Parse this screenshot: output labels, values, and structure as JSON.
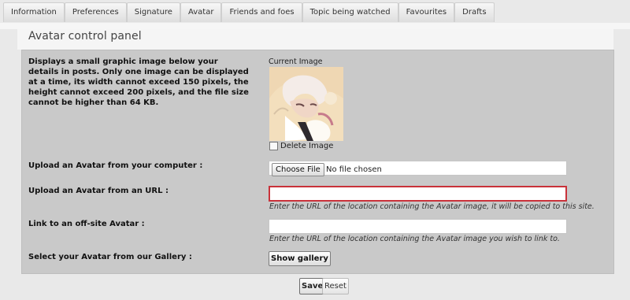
{
  "tabs": [
    {
      "label": "Information"
    },
    {
      "label": "Preferences"
    },
    {
      "label": "Signature"
    },
    {
      "label": "Avatar"
    },
    {
      "label": "Friends and foes"
    },
    {
      "label": "Topic being watched"
    },
    {
      "label": "Favourites"
    },
    {
      "label": "Drafts"
    }
  ],
  "panel": {
    "title": "Avatar control panel",
    "description": "Displays a small graphic image below your details in posts. Only one image can be displayed at a time, its width cannot exceed 150 pixels, the height cannot exceed 200 pixels, and the file size cannot be higher than 64 KB.",
    "current_image_label": "Current Image",
    "delete_image_label": "Delete Image",
    "delete_image_checked": false
  },
  "upload_computer": {
    "label": "Upload an Avatar from your computer :",
    "button_label": "Choose File",
    "status_text": "No file chosen"
  },
  "upload_url": {
    "label": "Upload an Avatar from an URL :",
    "value": "",
    "hint": "Enter the URL of the location containing the Avatar image, it will be copied to this site."
  },
  "link_offsite": {
    "label": "Link to an off-site Avatar :",
    "value": "",
    "hint": "Enter the URL of the location containing the Avatar image you wish to link to."
  },
  "gallery": {
    "label": "Select your Avatar from our Gallery :",
    "button_label": "Show gallery"
  },
  "actions": {
    "save_label": "Save",
    "reset_label": "Reset"
  },
  "colors": {
    "panel_bg": "#c9c9c9",
    "error_border": "#c9323a"
  }
}
